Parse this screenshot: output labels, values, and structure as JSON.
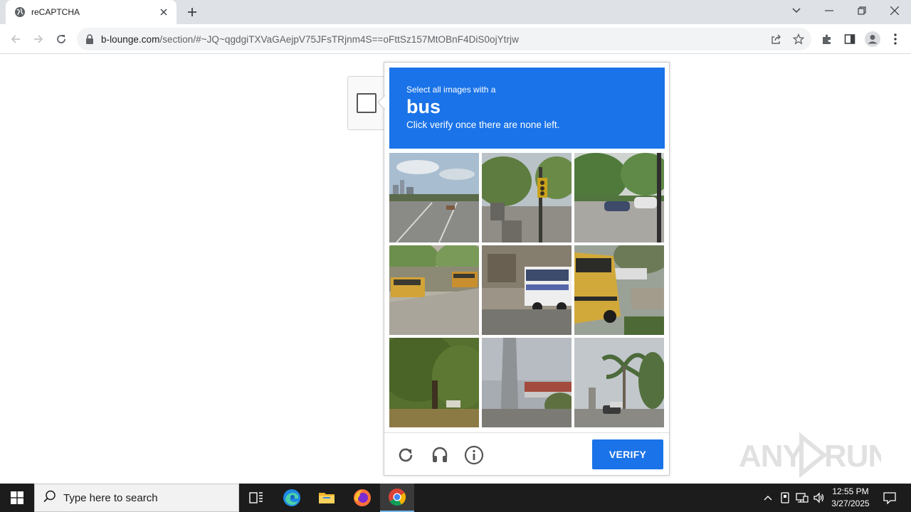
{
  "browser": {
    "tab_title": "reCAPTCHA",
    "url_host": "b-lounge.com",
    "url_path": "/section/#~JQ~qgdgiTXVaGAejpV75JFsTRjnm4S==oFttSz157MtOBnF4DiS0ojYtrjw"
  },
  "captcha": {
    "instruction_line1": "Select all images with a",
    "target_word": "bus",
    "instruction_line3": "Click verify once there are none left.",
    "verify_label": "VERIFY",
    "tiles": [
      {
        "name": "road-highway-scene",
        "colors": [
          "#9fb4c8",
          "#7d7f7a"
        ]
      },
      {
        "name": "traffic-light-trees",
        "colors": [
          "#6d8a4e",
          "#8c8a82"
        ]
      },
      {
        "name": "parking-lot-cars",
        "colors": [
          "#5f8a47",
          "#a7a5a0"
        ]
      },
      {
        "name": "school-buses-street",
        "colors": [
          "#7a9a5a",
          "#b3ada0"
        ]
      },
      {
        "name": "city-bus",
        "colors": [
          "#8a8275",
          "#6f6d68"
        ]
      },
      {
        "name": "yellow-school-bus",
        "colors": [
          "#c9a43a",
          "#6c7a58"
        ]
      },
      {
        "name": "trees-park",
        "colors": [
          "#4e6a30",
          "#8c7a45"
        ]
      },
      {
        "name": "overpass-bridge",
        "colors": [
          "#8a8f95",
          "#a34b3e"
        ]
      },
      {
        "name": "palm-trees-street",
        "colors": [
          "#b7bdc3",
          "#59704a"
        ]
      }
    ]
  },
  "watermark": "ANY RUN",
  "taskbar": {
    "search_placeholder": "Type here to search",
    "time": "12:55 PM",
    "date": "3/27/2025"
  },
  "colors": {
    "accent": "#1a73e8",
    "taskbar": "#1c1c1c"
  }
}
